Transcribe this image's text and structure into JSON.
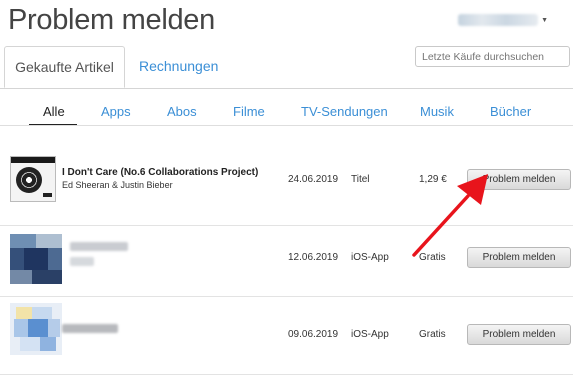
{
  "header": {
    "title": "Problem melden"
  },
  "tabs": [
    {
      "label": "Gekaufte Artikel",
      "active": true
    },
    {
      "label": "Rechnungen",
      "active": false
    }
  ],
  "search": {
    "placeholder": "Letzte Käufe durchsuchen"
  },
  "filters": [
    {
      "label": "Alle",
      "active": true
    },
    {
      "label": "Apps"
    },
    {
      "label": "Abos"
    },
    {
      "label": "Filme"
    },
    {
      "label": "TV-Sendungen"
    },
    {
      "label": "Musik"
    },
    {
      "label": "Bücher"
    }
  ],
  "rows": [
    {
      "title": "I Don't Care (No.6 Collaborations Project)",
      "artist": "Ed Sheeran & Justin Bieber",
      "date": "24.06.2019",
      "type": "Titel",
      "price": "1,29 €",
      "button": "Problem melden"
    },
    {
      "title": "",
      "date": "12.06.2019",
      "type": "iOS-App",
      "price": "Gratis",
      "button": "Problem melden"
    },
    {
      "title": "",
      "date": "09.06.2019",
      "type": "iOS-App",
      "price": "Gratis",
      "button": "Problem melden"
    }
  ],
  "colors": {
    "link": "#3b8fd6",
    "annotation_arrow": "#e8141c"
  },
  "icons": {
    "annotation": "red-arrow-icon"
  }
}
